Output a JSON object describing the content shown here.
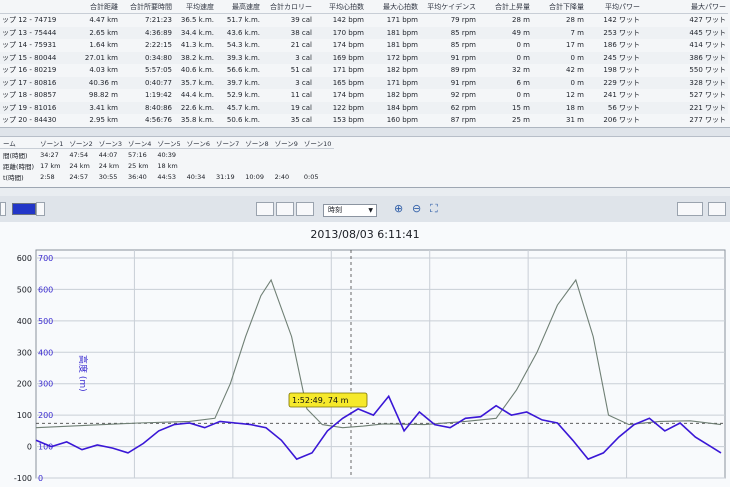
{
  "lap_table": {
    "headers": [
      "",
      "合計距離",
      "合計所要時間",
      "平均速度",
      "最高速度",
      "合計カロリー",
      "平均心拍数",
      "最大心拍数",
      "平均ケイデンス",
      "合計上昇量",
      "合計下降量",
      "平均パワー",
      "最大パワー"
    ],
    "rows": [
      [
        "ップ 12 - 74719",
        "4.47 km",
        "7:21:23",
        "36.5 k.m.",
        "51.7 k.m.",
        "39 cal",
        "142 bpm",
        "171 bpm",
        "79 rpm",
        "28 m",
        "28 m",
        "142 ワット",
        "427 ワット"
      ],
      [
        "ップ 13 - 75444",
        "2.65 km",
        "4:36:89",
        "34.4 k.m.",
        "43.6 k.m.",
        "38 cal",
        "170 bpm",
        "181 bpm",
        "85 rpm",
        "49 m",
        "7 m",
        "253 ワット",
        "445 ワット"
      ],
      [
        "ップ 14 - 75931",
        "1.64 km",
        "2:22:15",
        "41.3 k.m.",
        "54.3 k.m.",
        "21 cal",
        "174 bpm",
        "181 bpm",
        "85 rpm",
        "0 m",
        "17 m",
        "186 ワット",
        "414 ワット"
      ],
      [
        "ップ 15 - 80044",
        "27.01 km",
        "0:34:80",
        "38.2 k.m.",
        "39.3 k.m.",
        "3 cal",
        "169 bpm",
        "172 bpm",
        "91 rpm",
        "0 m",
        "0 m",
        "245 ワット",
        "386 ワット"
      ],
      [
        "ップ 16 - 80219",
        "4.03 km",
        "5:57:05",
        "40.6 k.m.",
        "56.6 k.m.",
        "51 cal",
        "171 bpm",
        "182 bpm",
        "89 rpm",
        "32 m",
        "42 m",
        "198 ワット",
        "550 ワット"
      ],
      [
        "ップ 17 - 80816",
        "40.36 m",
        "0:40:77",
        "35.7 k.m.",
        "39.7 k.m.",
        "3 cal",
        "165 bpm",
        "171 bpm",
        "91 rpm",
        "6 m",
        "0 m",
        "229 ワット",
        "328 ワット"
      ],
      [
        "ップ 18 - 80857",
        "98.82 m",
        "1:19:42",
        "44.4 k.m.",
        "52.9 k.m.",
        "11 cal",
        "174 bpm",
        "182 bpm",
        "92 rpm",
        "0 m",
        "12 m",
        "241 ワット",
        "527 ワット"
      ],
      [
        "ップ 19 - 81016",
        "3.41 km",
        "8:40:86",
        "22.6 k.m.",
        "45.7 k.m.",
        "19 cal",
        "122 bpm",
        "184 bpm",
        "62 rpm",
        "15 m",
        "18 m",
        "56 ワット",
        "221 ワット"
      ],
      [
        "ップ 20 - 84430",
        "2.95 km",
        "4:56:76",
        "35.8 k.m.",
        "50.6 k.m.",
        "35 cal",
        "153 bpm",
        "160 bpm",
        "87 rpm",
        "25 m",
        "31 m",
        "206 ワット",
        "277 ワット"
      ]
    ]
  },
  "zone_table": {
    "headers": [
      "ーム",
      "ゾーン1",
      "ゾーン2",
      "ゾーン3",
      "ゾーン4",
      "ゾーン5",
      "ゾーン6",
      "ゾーン7",
      "ゾーン8",
      "ゾーン9",
      "ゾーン10"
    ],
    "rows": [
      [
        "間(時間)",
        "34:27",
        "47:54",
        "44:07",
        "57:16",
        "40:39",
        "",
        "",
        "",
        "",
        ""
      ],
      [
        "距離(時間)",
        "17 km",
        "24 km",
        "24 km",
        "25 km",
        "18 km",
        "",
        "",
        "",
        "",
        ""
      ],
      [
        "t(時間)",
        "2:58",
        "24:57",
        "30:55",
        "36:40",
        "44:53",
        "40:34",
        "31:19",
        "10:09",
        "2:40",
        "0:05"
      ]
    ]
  },
  "toolbar": {
    "color_swatch": "#2236c8",
    "time_select": "時刻",
    "icons": [
      "zoom-in-icon",
      "zoom-out-icon",
      "fit-icon"
    ]
  },
  "chart_data": {
    "type": "line",
    "title": "2013/08/03 6:11:41",
    "ylabel": "高度 (m)",
    "left_axis_ticks": [
      "-100",
      "0",
      "100",
      "200",
      "300",
      "400",
      "500",
      "600"
    ],
    "left_axis_ylim": [
      -100,
      600
    ],
    "right_axis_ticks": [
      "0",
      "100",
      "200",
      "300",
      "400",
      "500",
      "600",
      "700"
    ],
    "right_axis_ylim": [
      0,
      700
    ],
    "grid": true,
    "tooltip": "1:52:49, 74 m",
    "series": [
      {
        "color": "#6f7f74",
        "x": [
          0,
          100,
          150,
          175,
          190,
          205,
          220,
          230,
          250,
          265,
          280,
          300,
          320,
          340,
          380,
          420,
          450,
          470,
          490,
          510,
          528,
          545,
          560,
          580,
          610,
          640,
          670
        ],
        "values": [
          60,
          75,
          80,
          90,
          200,
          350,
          480,
          530,
          350,
          120,
          70,
          60,
          65,
          72,
          70,
          80,
          90,
          180,
          300,
          450,
          530,
          350,
          100,
          70,
          80,
          82,
          70
        ]
      },
      {
        "color": "#3a17d6",
        "x": [
          0,
          15,
          30,
          45,
          60,
          75,
          90,
          105,
          120,
          135,
          150,
          165,
          180,
          195,
          210,
          225,
          240,
          255,
          270,
          285,
          300,
          315,
          330,
          345,
          360,
          375,
          390,
          405,
          420,
          435,
          450,
          465,
          480,
          495,
          510,
          525,
          540,
          555,
          570,
          585,
          600,
          615,
          630,
          645,
          660,
          670
        ],
        "values": [
          120,
          100,
          115,
          90,
          105,
          95,
          80,
          110,
          150,
          170,
          175,
          160,
          180,
          175,
          170,
          160,
          120,
          60,
          80,
          150,
          190,
          220,
          200,
          260,
          150,
          210,
          170,
          160,
          190,
          195,
          230,
          200,
          210,
          185,
          175,
          120,
          60,
          80,
          130,
          170,
          190,
          150,
          175,
          130,
          100,
          80
        ]
      }
    ]
  }
}
